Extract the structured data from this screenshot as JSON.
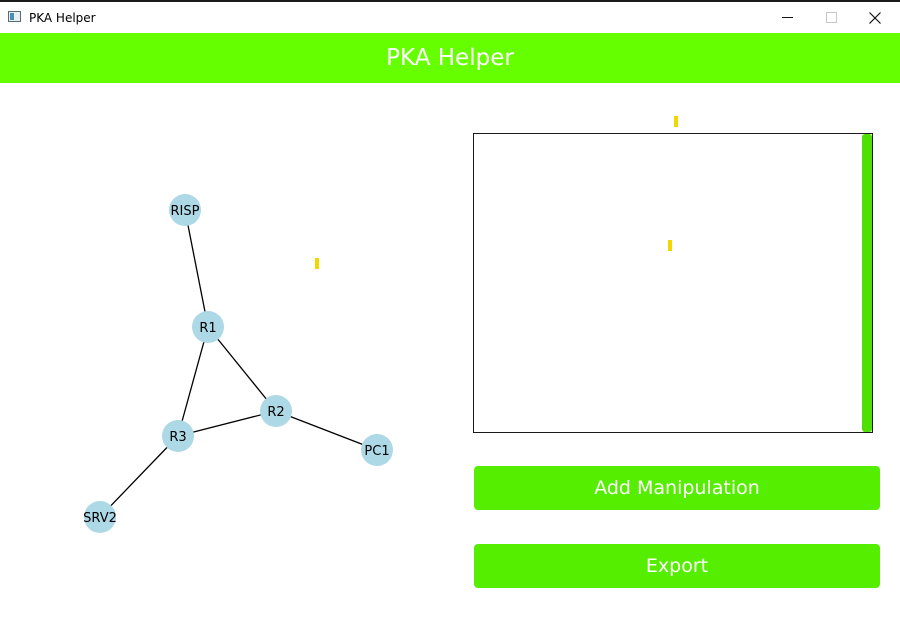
{
  "window": {
    "title": "PKA Helper",
    "controls": {
      "minimize": "minimize",
      "maximize": "maximize",
      "close": "close"
    }
  },
  "header": {
    "title": "PKA Helper"
  },
  "colors": {
    "accent": "#66ff00",
    "button": "#55ee00",
    "node": "#add8e6",
    "marker": "#f2d600"
  },
  "graph": {
    "nodes": [
      {
        "id": "RISP",
        "label": "RISP"
      },
      {
        "id": "R1",
        "label": "R1"
      },
      {
        "id": "R2",
        "label": "R2"
      },
      {
        "id": "R3",
        "label": "R3"
      },
      {
        "id": "PC1",
        "label": "PC1"
      },
      {
        "id": "SRV2",
        "label": "SRV2"
      }
    ],
    "edges": [
      [
        "RISP",
        "R1"
      ],
      [
        "R1",
        "R2"
      ],
      [
        "R1",
        "R3"
      ],
      [
        "R3",
        "R2"
      ],
      [
        "R2",
        "PC1"
      ],
      [
        "R3",
        "SRV2"
      ]
    ]
  },
  "actions": {
    "add_manipulation": "Add Manipulation",
    "export": "Export"
  }
}
